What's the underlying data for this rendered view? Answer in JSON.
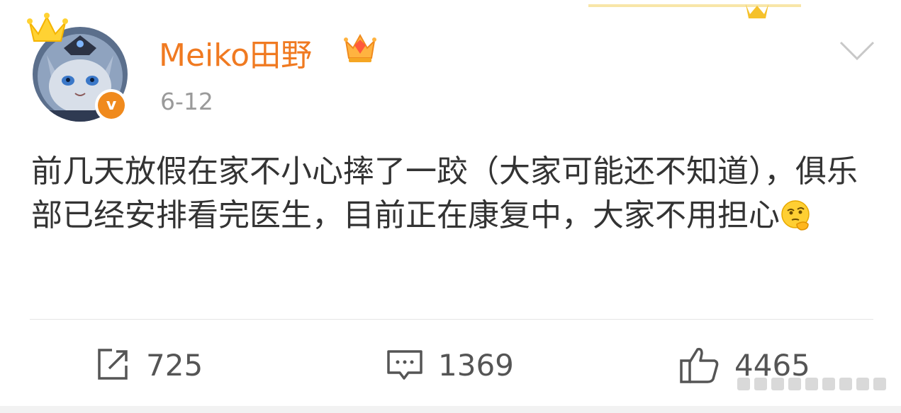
{
  "post": {
    "username": "Meiko田野",
    "date": "6-12",
    "text": "前几天放假在家不小心摔了一跤（大家可能还不知道），俱乐部已经安排看完医生，目前正在康复中，大家不用担心",
    "emoji_icon": "thinking-face-emoji",
    "verified_mark": "v"
  },
  "actions": {
    "repost_count": "725",
    "comment_count": "1369",
    "like_count": "4465"
  },
  "icons": {
    "avatar": "cat-avatar",
    "avatar_crown": "crown-icon",
    "vip_badge": "vip-crown-icon",
    "more": "chevron-down-icon",
    "repost": "repost-icon",
    "comment": "comment-icon",
    "like": "thumbs-up-icon"
  },
  "colors": {
    "username": "#f07a21",
    "verified": "#f08a1d",
    "text": "#333333",
    "meta": "#9a9a9a"
  }
}
